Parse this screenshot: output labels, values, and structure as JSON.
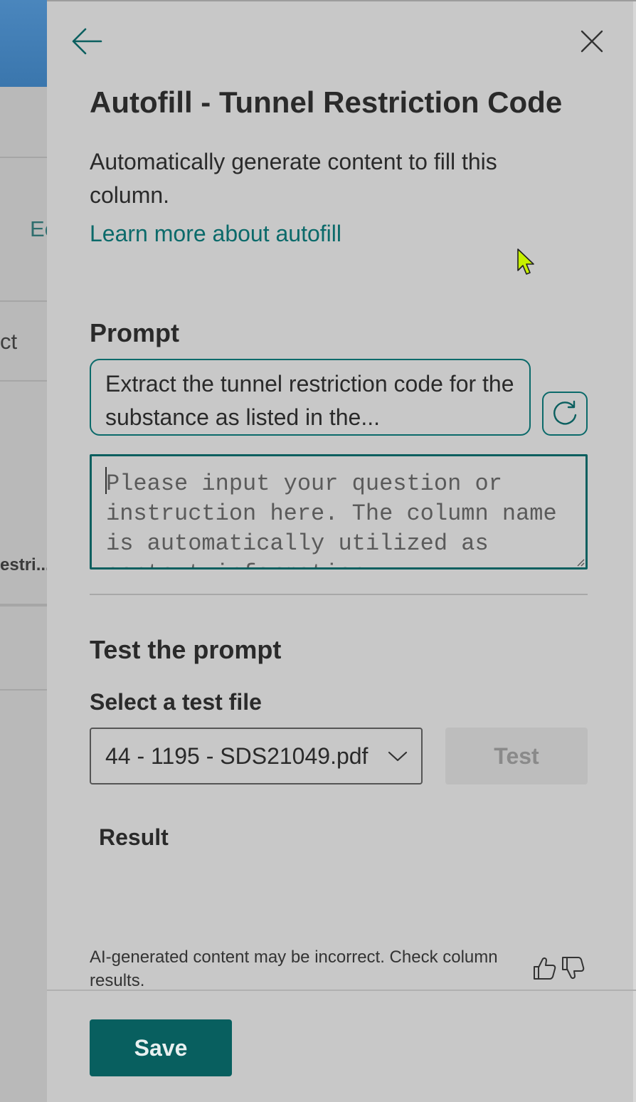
{
  "background": {
    "fragments": [
      "Ec",
      "ct",
      "estri..."
    ]
  },
  "panel": {
    "title": "Autofill - Tunnel Restriction Code",
    "description": "Automatically generate content to fill this column.",
    "learn_more_link": "Learn more about autofill",
    "prompt_section": {
      "heading": "Prompt",
      "suggested_prompt": "Extract the tunnel restriction code for the substance as listed in the...",
      "input_placeholder": "Please input your question or instruction here. The column name is automatically utilized as context information.",
      "input_value": ""
    },
    "test_section": {
      "heading": "Test the prompt",
      "select_label": "Select a test file",
      "selected_file": "44 - 1195 - SDS21049.pdf",
      "test_button": "Test",
      "result_label": "Result"
    },
    "disclaimer": "AI-generated content may be incorrect. Check column results.",
    "save_button": "Save"
  },
  "icons": {
    "back": "arrow-left-icon",
    "close": "close-icon",
    "refresh": "refresh-icon",
    "chevron": "chevron-down-icon",
    "thumb_up": "thumbs-up-icon",
    "thumb_down": "thumbs-down-icon",
    "cursor": "mouse-pointer-icon"
  },
  "colors": {
    "accent": "#085f5f",
    "link": "#0b6a6a",
    "panel_bg": "#c8c8c8",
    "header_blue": "#4a86bd"
  }
}
